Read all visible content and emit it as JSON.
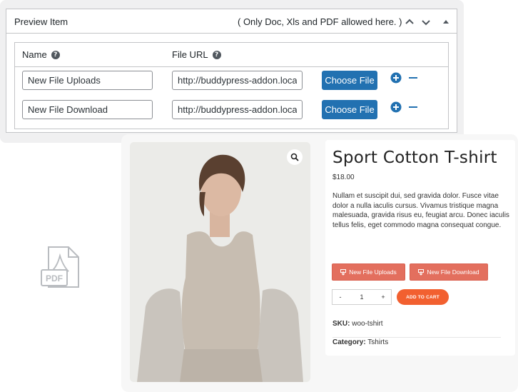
{
  "metabox": {
    "title": "Preview Item",
    "note": "( Only Doc, Xls and PDF allowed here. )",
    "icons": [
      "chevron-up-icon",
      "chevron-down-icon",
      "collapse-triangle-icon"
    ],
    "columns": {
      "name": "Name",
      "file_url": "File URL"
    },
    "rows": [
      {
        "name": "New File Uploads",
        "url": "http://buddypress-addon.local",
        "button": "Choose File"
      },
      {
        "name": "New File Download",
        "url": "http://buddypress-addon.local",
        "button": "Choose File"
      }
    ],
    "colors": {
      "primary": "#2271b1",
      "border": "#c3c4c7"
    }
  },
  "product": {
    "title": "Sport Cotton T-shirt",
    "price": "$18.00",
    "description": "Nullam et suscipit dui, sed gravida dolor. Fusce vitae dolor a nulla iaculis cursus. Vivamus tristique magna malesuada, gravida risus eu, feugiat arcu. Donec iaculis tellus felis, eget commodo magna consequat congue.",
    "file_buttons": [
      "New File Uploads",
      "New File Download"
    ],
    "quantity": {
      "minus": "-",
      "value": "1",
      "plus": "+"
    },
    "add_to_cart": "ADD TO CART",
    "sku_label": "SKU:",
    "sku": "woo-tshirt",
    "category_label": "Category:",
    "category": "Tshirts",
    "colors": {
      "file_button": "#e36f5e",
      "cart_button": "#f26030"
    }
  }
}
